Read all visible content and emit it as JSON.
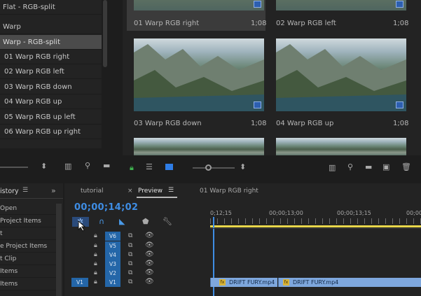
{
  "bin_list": {
    "items": [
      {
        "label": "Flat - RGB-split",
        "selected": false,
        "child": false
      },
      {
        "label": "Warp",
        "selected": false,
        "child": false
      },
      {
        "label": "Warp - RGB-split",
        "selected": true,
        "child": false
      },
      {
        "label": "01 Warp RGB right",
        "selected": false,
        "child": true
      },
      {
        "label": "02 Warp RGB left",
        "selected": false,
        "child": true
      },
      {
        "label": "03 Warp RGB down",
        "selected": false,
        "child": true
      },
      {
        "label": "04 Warp RGB up",
        "selected": false,
        "child": true
      },
      {
        "label": "05 Warp RGB up left",
        "selected": false,
        "child": true
      },
      {
        "label": "06 Warp RGB up right",
        "selected": false,
        "child": true
      }
    ]
  },
  "media_grid": {
    "tiles": [
      {
        "label": "01 Warp RGB right",
        "duration": "1;08"
      },
      {
        "label": "02 Warp RGB left",
        "duration": "1;08"
      },
      {
        "label": "03 Warp RGB down",
        "duration": "1;08"
      },
      {
        "label": "04 Warp RGB up",
        "duration": "1;08"
      }
    ]
  },
  "history": {
    "title": "istory",
    "items": [
      "Open",
      "Project Items",
      "t",
      "e Project Items",
      "t Clip",
      "Items",
      "Items"
    ]
  },
  "timeline": {
    "tabs": [
      "tutorial",
      "Preview",
      "01 Warp RGB right"
    ],
    "timecode": "00;00;14;02",
    "ruler_labels": [
      "0;12;15",
      "00;00;13;00",
      "00;00;13;15",
      "00;00;1"
    ],
    "tracks": [
      "V6",
      "V5",
      "V4",
      "V3",
      "V2",
      "V1"
    ],
    "source_patch": "V1",
    "clips": [
      "DRIFT FURY.mp4",
      "DRIFT FURY.mp4"
    ],
    "clip_fx_label": "fx"
  },
  "colors": {
    "accent_blue": "#2466a8",
    "timecode_blue": "#3e8de4",
    "clip_blue": "#7ea7dd",
    "playhead_yellow": "#e8d64a"
  }
}
